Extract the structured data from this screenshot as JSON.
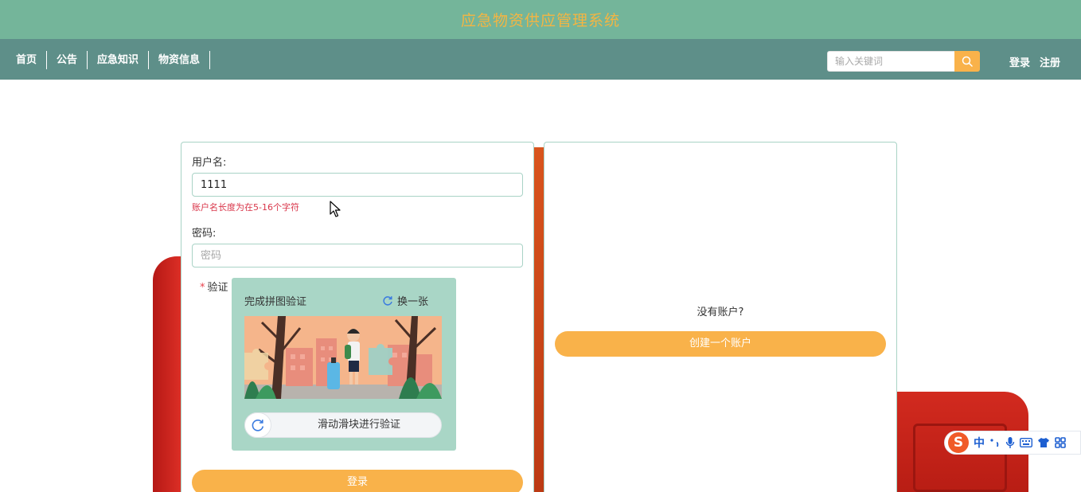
{
  "header": {
    "title": "应急物资供应管理系统"
  },
  "nav": {
    "items": [
      {
        "label": "首页"
      },
      {
        "label": "公告"
      },
      {
        "label": "应急知识"
      },
      {
        "label": "物资信息"
      }
    ],
    "search": {
      "placeholder": "输入关键词",
      "value": ""
    },
    "login_label": "登录",
    "register_label": "注册"
  },
  "login_form": {
    "username_label": "用户名:",
    "username_value": "1111",
    "username_error": "账户名长度为在5-16个字符",
    "password_label": "密码:",
    "password_placeholder": "密码",
    "verify_required_mark": "*",
    "verify_label": "验证",
    "captcha": {
      "title": "完成拼图验证",
      "refresh_label": "换一张",
      "slider_text": "滑动滑块进行验证"
    },
    "submit_label": "登录"
  },
  "register_panel": {
    "prompt": "没有账户?",
    "create_label": "创建一个账户"
  },
  "ime": {
    "logo": "S",
    "mode": "中"
  },
  "colors": {
    "title_bar": "#74b59a",
    "nav_bar": "#5e8f89",
    "title_text": "#f4b542",
    "accent": "#f9b24a",
    "error": "#d9364a",
    "card_border": "#a9d3c6",
    "captcha_bg": "#a9d6c6"
  }
}
